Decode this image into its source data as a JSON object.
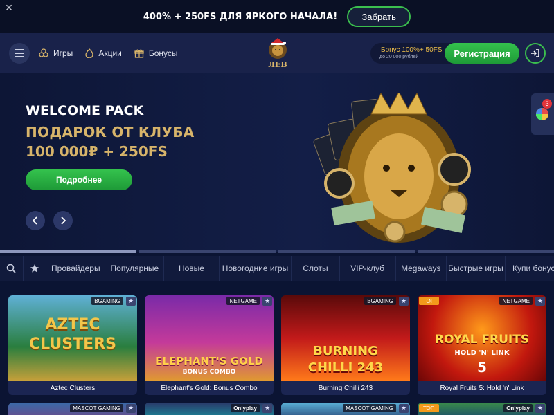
{
  "promo": {
    "close_icon": "close-icon",
    "text": "400% + 250FS ДЛЯ ЯРКОГО НАЧАЛА!",
    "button": "Забрать"
  },
  "header": {
    "nav": [
      {
        "label": "Игры",
        "icon": "clover-icon"
      },
      {
        "label": "Акции",
        "icon": "flame-icon"
      },
      {
        "label": "Бонусы",
        "icon": "gift-icon"
      }
    ],
    "logo_text": "ЛЕВ",
    "bonus_line1": "Бонус 100%+ 50FS",
    "bonus_line2": "до 20 000 рублей",
    "register": "Регистрация",
    "login_icon": "login-icon"
  },
  "banner": {
    "title": "WELCOME PACK",
    "subtitle1": "ПОДАРОК ОТ КЛУБА",
    "subtitle2": "100 000₽ + 250FS",
    "button": "Подробнее",
    "side_badge": "3",
    "slides_count": 4,
    "active_slide": 1
  },
  "categories": {
    "search_icon": "search-icon",
    "favorites_icon": "star-icon",
    "items": [
      "Провайдеры",
      "Популярные",
      "Новые",
      "Новогодние игры",
      "Слоты",
      "VIP-клуб",
      "Megaways",
      "Быстрые игры",
      "Купи бонус"
    ]
  },
  "games": [
    {
      "name": "Aztec Clusters",
      "provider": "BGAMING",
      "art_line1": "AZTEC",
      "art_line2": "CLUSTERS",
      "top": false
    },
    {
      "name": "Elephant's Gold: Bonus Combo",
      "provider": "NETGAME",
      "art_line1": "ELEPHANT'S GOLD",
      "art_line2": "BONUS COMBO",
      "top": false
    },
    {
      "name": "Burning Chilli 243",
      "provider": "BGAMING",
      "art_line1": "BURNING",
      "art_line2": "CHILLI 243",
      "top": false
    },
    {
      "name": "Royal Fruits 5: Hold 'n' Link",
      "provider": "NETGAME",
      "art_line1": "ROYAL FRUITS",
      "art_line2": "HOLD 'N' LINK",
      "art_line3": "5",
      "top": true,
      "top_label": "ТОП"
    }
  ],
  "games_row2": [
    {
      "provider": "MASCOT GAMING",
      "top": false
    },
    {
      "provider": "Onlyplay",
      "top": false
    },
    {
      "provider": "MASCOT GAMING",
      "top": false
    },
    {
      "provider": "Onlyplay",
      "top": true,
      "top_label": "ТОП"
    }
  ],
  "colors": {
    "accent_green": "#2fb948",
    "gold": "#d7b46a",
    "bg": "#0b1433"
  }
}
